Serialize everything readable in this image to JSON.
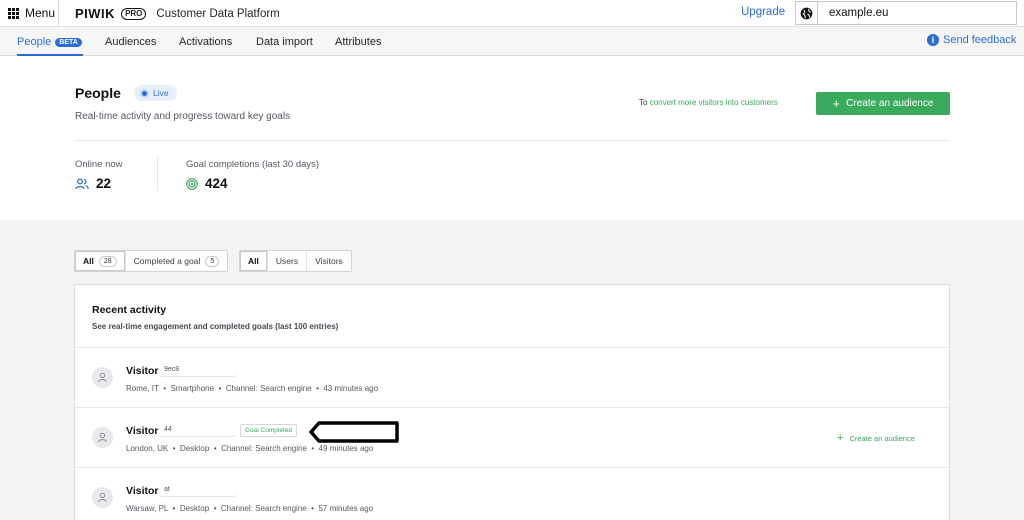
{
  "topbar": {
    "menu_label": "Menu",
    "brand_logo": "PIWIK",
    "brand_pro": "PRO",
    "product_name": "Customer Data Platform",
    "upgrade_label": "Upgrade",
    "site_name": "example.eu",
    "icons": [
      "grid-icon",
      "globe-icon"
    ]
  },
  "nav": {
    "items": [
      {
        "label": "People",
        "badge": "BETA",
        "active": true
      },
      {
        "label": "Audiences"
      },
      {
        "label": "Activations"
      },
      {
        "label": "Data import"
      },
      {
        "label": "Attributes"
      }
    ],
    "feedback_label": "Send feedback"
  },
  "header": {
    "title": "People",
    "status": "Live",
    "subtitle": "Real-time activity and progress toward key goals",
    "convert_prefix": "To",
    "convert_link": "convert more visitors into customers",
    "create_label": "Create an audience",
    "stats": [
      {
        "label": "Online now",
        "value": "22",
        "icon": "users-icon"
      },
      {
        "label": "Goal completions (last 30 days)",
        "value": "424",
        "icon": "target-icon"
      }
    ]
  },
  "filters": {
    "activity": [
      {
        "label": "All",
        "count": "28",
        "selected": true
      },
      {
        "label": "Completed a goal",
        "count": "5"
      }
    ],
    "type": [
      {
        "label": "All",
        "selected": true
      },
      {
        "label": "Users"
      },
      {
        "label": "Visitors"
      }
    ]
  },
  "activity": {
    "title": "Recent activity",
    "subtitle": "See real-time engagement and completed goals (last 100 entries)",
    "rows": [
      {
        "name": "Visitor",
        "id": "9ec8",
        "location": "Rome, IT",
        "device": "Smartphone",
        "channel": "Channel: Search engine",
        "time": "43 minutes ago"
      },
      {
        "name": "Visitor",
        "id": "44",
        "badge": "Goal Completed",
        "location": "London, UK",
        "device": "Desktop",
        "channel": "Channel: Search engine",
        "time": "49 minutes ago",
        "action": "Create an audience"
      },
      {
        "name": "Visitor",
        "id": "at",
        "location": "Warsaw, PL",
        "device": "Desktop",
        "channel": "Channel: Search engine",
        "time": "57 minutes ago"
      }
    ],
    "separator": "•"
  },
  "colors": {
    "accent": "#2a6dd9",
    "success": "#3aaa5c"
  }
}
